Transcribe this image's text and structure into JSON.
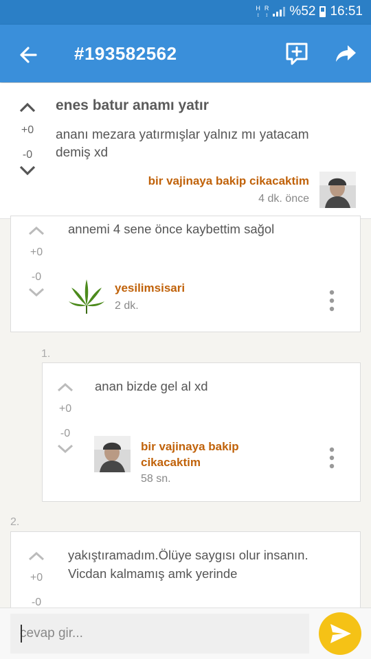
{
  "status_bar": {
    "net_top": "H",
    "net_bottom": "R",
    "battery": "%52",
    "time": "16:51"
  },
  "app_bar": {
    "title": "#193582562",
    "back_icon": "arrow-left-icon",
    "new_comment_icon": "add-comment-icon",
    "share_icon": "share-icon"
  },
  "post": {
    "upvotes": "+0",
    "downvotes": "-0",
    "title": "enes batur anamı yatır",
    "body": "ananı mezara yatırmışlar yalnız mı yatacam demiş xd",
    "author": "bir vajinaya bakip cikacaktim",
    "time": "4 dk. önce"
  },
  "comments": [
    {
      "upvotes": "+0",
      "downvotes": "-0",
      "text": "annemi 4 sene önce kaybettim sağol",
      "author": "yesilimsisari",
      "time": "2 dk."
    },
    {
      "number": "1.",
      "upvotes": "+0",
      "downvotes": "-0",
      "text": "anan bizde gel al xd",
      "author": "bir vajinaya bakip cikacaktim",
      "time": "58 sn."
    },
    {
      "number": "2.",
      "upvotes": "+0",
      "downvotes": "-0",
      "text": "yakıştıramadım.Ölüye saygısı olur insanın. Vicdan kalmamış amk yerinde"
    }
  ],
  "reply_bar": {
    "placeholder": "cevap gir...",
    "send_icon": "send-icon"
  },
  "colors": {
    "status_bar": "#2b7fc6",
    "app_bar": "#3a8fda",
    "author": "#c0620a",
    "send_button": "#f5c216"
  }
}
